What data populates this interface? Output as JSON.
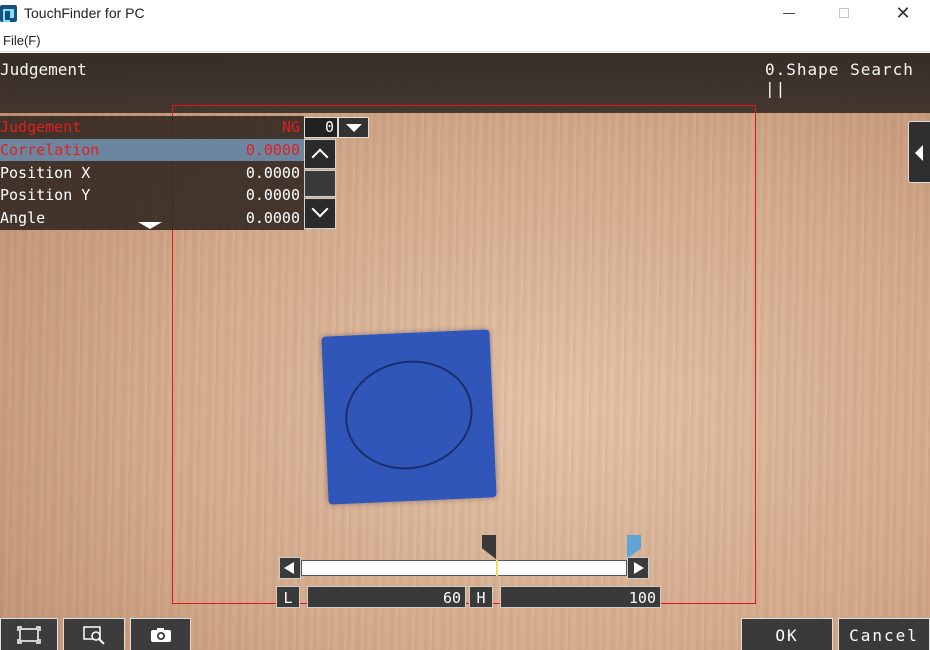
{
  "window": {
    "title": "TouchFinder for PC",
    "minimize_icon": "minimize-icon",
    "maximize_icon": "maximize-icon",
    "close_glyph": "✕"
  },
  "menu": {
    "file": "File(F)"
  },
  "header": {
    "screen_title": "Judgement",
    "unit_name": "0.Shape Search ||"
  },
  "results": {
    "rows": [
      {
        "label": "Judgement",
        "value": "NG",
        "color": "#e02020"
      },
      {
        "label": "Correlation",
        "value": "0.0000",
        "color": "#e02020",
        "selected": true
      },
      {
        "label": "Position X",
        "value": "0.0000"
      },
      {
        "label": "Position Y",
        "value": "0.0000"
      },
      {
        "label": "Angle",
        "value": "0.0000"
      }
    ],
    "index_value": "0"
  },
  "threshold": {
    "low_label": "L",
    "low_value": "60",
    "high_label": "H",
    "high_value": "100"
  },
  "toolbar": {
    "ok_label": "OK",
    "cancel_label": "Cancel"
  },
  "colors": {
    "roi": "#e01818",
    "accent_selected": "#6c86a0",
    "ng": "#e02020"
  }
}
